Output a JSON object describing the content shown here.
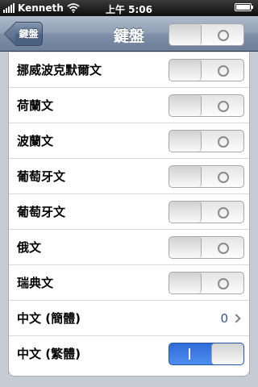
{
  "status_bar": {
    "carrier": "Kenneth",
    "time": "上午 5:06"
  },
  "nav": {
    "back_label": "鍵盤",
    "title": "鍵盤"
  },
  "rows": [
    {
      "label": "挪威波克默爾文",
      "type": "switch",
      "on": false
    },
    {
      "label": "荷蘭文",
      "type": "switch",
      "on": false
    },
    {
      "label": "波蘭文",
      "type": "switch",
      "on": false
    },
    {
      "label": "葡萄牙文",
      "type": "switch",
      "on": false
    },
    {
      "label": "葡萄牙文",
      "type": "switch",
      "on": false
    },
    {
      "label": "俄文",
      "type": "switch",
      "on": false
    },
    {
      "label": "瑞典文",
      "type": "switch",
      "on": false
    },
    {
      "label": "中文 (簡體)",
      "type": "disclosure",
      "count": "0"
    },
    {
      "label": "中文 (繁體)",
      "type": "switch",
      "on": true
    }
  ],
  "colors": {
    "switch_on": "#3d7ee6",
    "nav_bar": "#8d9db3",
    "background": "#c5ccd4"
  },
  "icons": [
    "signal-bars-icon",
    "wifi-icon",
    "battery-icon",
    "back-arrow-icon",
    "chevron-right-icon"
  ]
}
